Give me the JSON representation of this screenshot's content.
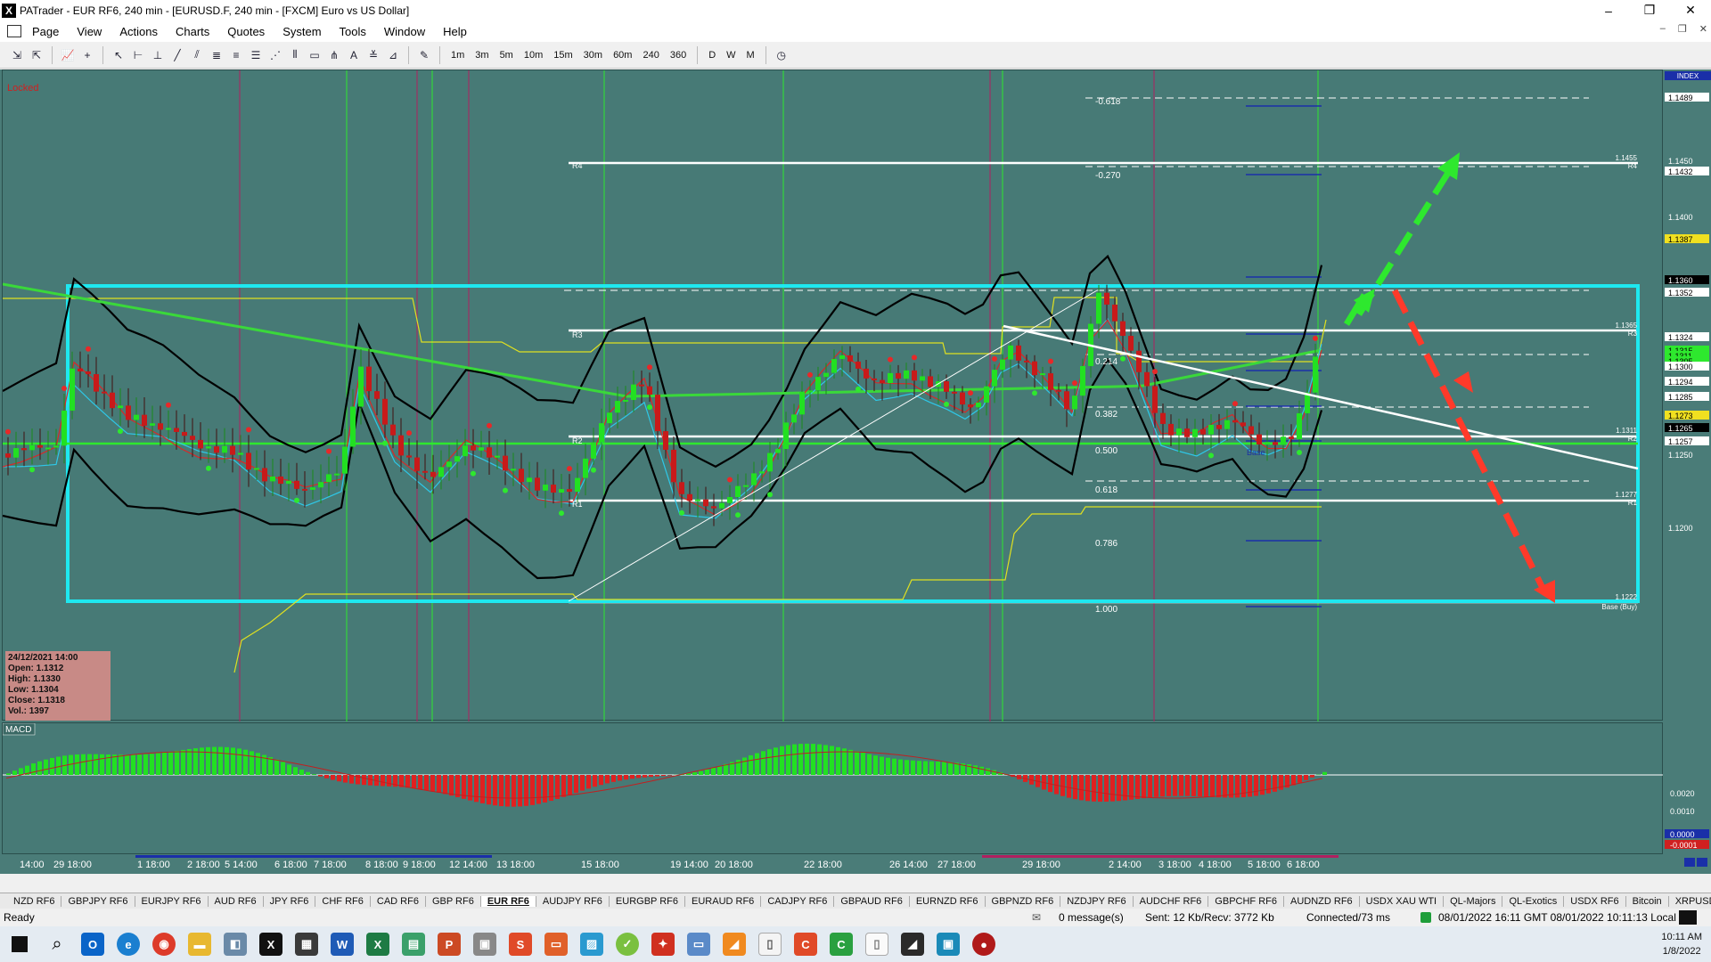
{
  "window": {
    "title": "PATrader - EUR RF6, 240 min - [EURUSD.F, 240 min - [FXCM] Euro vs US Dollar]",
    "app_icon": "X",
    "controls": [
      "–",
      "❐",
      "✕"
    ]
  },
  "menu": {
    "items": [
      "Page",
      "View",
      "Actions",
      "Charts",
      "Quotes",
      "System",
      "Tools",
      "Window",
      "Help"
    ],
    "mdi_controls": [
      "–",
      "❐",
      "✕"
    ]
  },
  "toolbar": {
    "timeframes": [
      "1m",
      "3m",
      "5m",
      "10m",
      "15m",
      "30m",
      "60m",
      "240",
      "360"
    ],
    "periods": [
      "D",
      "W",
      "M"
    ]
  },
  "chart": {
    "locked_label": "Locked",
    "index_label": "INDEX",
    "macd_label": "MACD",
    "ohlc": {
      "date": "24/12/2021 14:00",
      "open": "Open: 1.1312",
      "high": "High: 1.1330",
      "low": "Low: 1.1304",
      "close": "Close: 1.1318",
      "vol": "Vol.: 1397"
    },
    "fib_labels": [
      "-0.618",
      "-0.270",
      "0.214",
      "0.382",
      "0.500",
      "0.618",
      "0.786",
      "1.000"
    ],
    "pivot_labels": [
      "R4",
      "R3",
      "R2",
      "R1"
    ],
    "right_labels": {
      "r4": "1.1455",
      "r4_name": "R4",
      "r3": "1.1365",
      "r3_name": "R3",
      "r2": "1.1311",
      "r2_name": "R2",
      "r1": "1.1277",
      "r1_name": "R1",
      "base": "1.1222",
      "base_name": "Base (Buy)",
      "base_mid": "Base"
    },
    "price_axis": [
      "1.1489",
      "1.1450",
      "1.1432",
      "1.1400",
      "1.1387",
      "1.1360",
      "1.1352",
      "1.1324",
      "1.1315",
      "1.1311",
      "1.1305",
      "1.1300",
      "1.1294",
      "1.1285",
      "1.1273",
      "1.1265",
      "1.1257",
      "1.1250",
      "1.1200"
    ],
    "macd_axis": [
      "0.0020",
      "0.0010",
      "0.0000",
      "-0.0001",
      "-0.0010",
      "-0.0020",
      "-0.0030"
    ],
    "dates": [
      "14:00",
      "29 18:00",
      "1 18:00",
      "2 18:00",
      "5 14:00",
      "6 18:00",
      "7 18:00",
      "8 18:00",
      "9 18:00",
      "12 14:00",
      "13 18:00",
      "15 18:00",
      "19 14:00",
      "20 18:00",
      "22 18:00",
      "26 14:00",
      "27 18:00",
      "29 18:00",
      "2 14:00",
      "3 18:00",
      "4 18:00",
      "5 18:00",
      "6 18:00"
    ]
  },
  "symbol_tabs": [
    "NZD RF6",
    "GBPJPY RF6",
    "EURJPY RF6",
    "AUD RF6",
    "JPY RF6",
    "CHF RF6",
    "CAD RF6",
    "GBP RF6",
    "EUR RF6",
    "AUDJPY RF6",
    "EURGBP RF6",
    "EURAUD RF6",
    "CADJPY RF6",
    "GBPAUD RF6",
    "EURNZD RF6",
    "GBPNZD RF6",
    "NZDJPY RF6",
    "AUDCHF RF6",
    "GBPCHF RF6",
    "AUDNZD RF6",
    "USDX XAU WTI",
    "QL-Majors",
    "QL-Exotics",
    "USDX RF6",
    "Bitcoin",
    "XRPUSDRF6"
  ],
  "active_tab": "EUR RF6",
  "status": {
    "ready": "Ready",
    "messages": "0 message(s)",
    "traffic": "Sent: 12 Kb/Recv: 3772 Kb",
    "connection": "Connected/73 ms",
    "time": "08/01/2022 16:11 GMT  08/01/2022 10:11:13 Local"
  },
  "taskbar": {
    "time": "10:11 AM",
    "date": "1/8/2022"
  },
  "colors": {
    "chart_bg": "#477a76",
    "box": "#1ee8f0",
    "bull": "#22e022",
    "bear": "#e02020",
    "arrow_up": "#2ee82e",
    "arrow_down": "#ff3a2a"
  }
}
